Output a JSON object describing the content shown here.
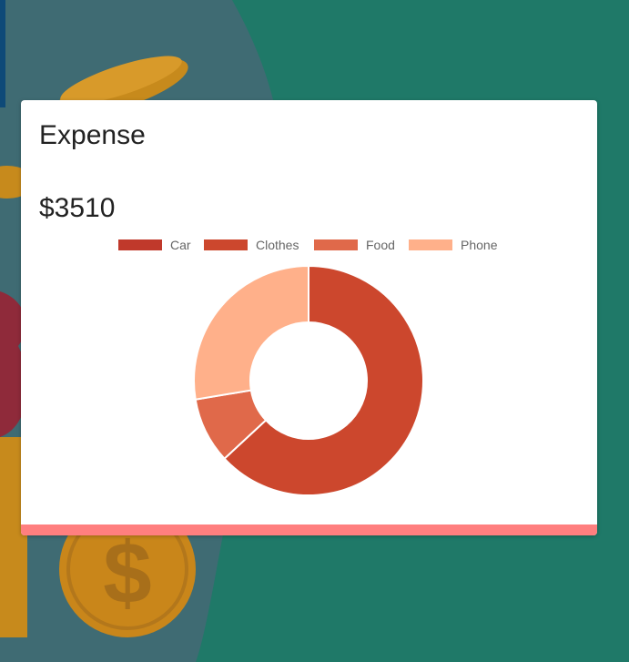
{
  "card": {
    "title": "Expense",
    "total": "$3510",
    "footer_color": "#ff7f7f"
  },
  "chart_data": {
    "type": "pie",
    "donut": true,
    "legend_position": "top",
    "labels": [
      "Car",
      "Clothes",
      "Food",
      "Phone"
    ],
    "values": [
      0,
      2215,
      325,
      970
    ],
    "colors": [
      "#c0392b",
      "#cc472d",
      "#e0694a",
      "#ffb08a"
    ]
  }
}
